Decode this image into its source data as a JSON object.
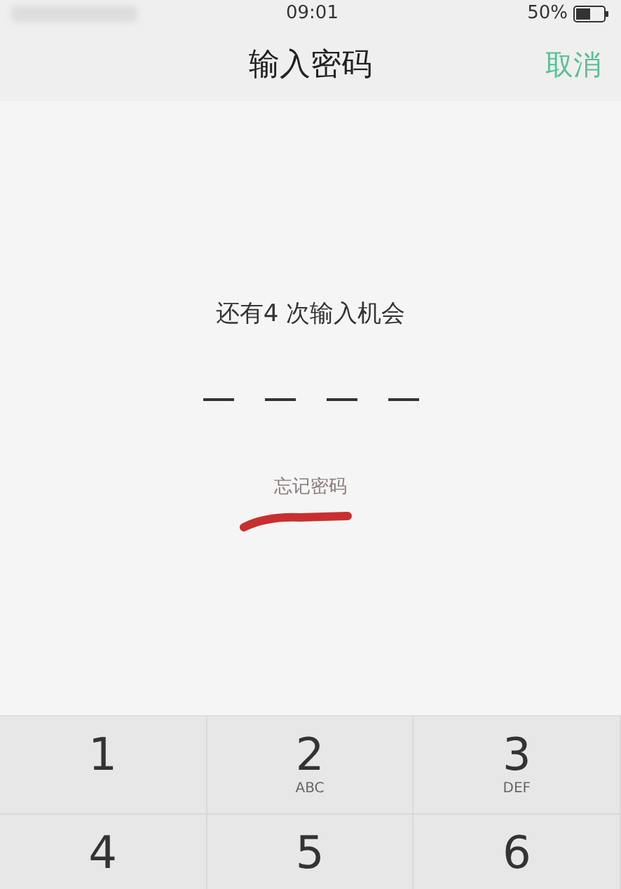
{
  "status_bar": {
    "time": "09:01",
    "battery": "50%"
  },
  "nav": {
    "title": "输入密码",
    "cancel": "取消"
  },
  "prompt": "还有4 次输入机会",
  "pin_slots": [
    {
      "filled": false
    },
    {
      "filled": false
    },
    {
      "filled": false
    },
    {
      "filled": false
    }
  ],
  "forgot_link": "忘记密码",
  "keypad": [
    {
      "digit": "1"
    },
    {
      "digit": "2",
      "letters": "ABC"
    },
    {
      "digit": "3",
      "letters": "DEF"
    },
    {
      "digit": "4"
    },
    {
      "digit": "5"
    },
    {
      "digit": "6"
    }
  ]
}
